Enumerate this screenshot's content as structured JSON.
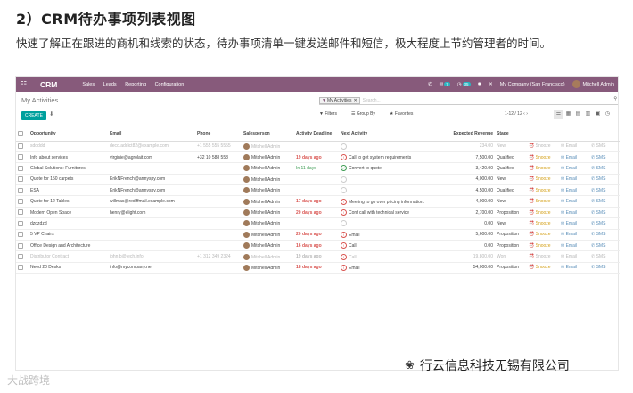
{
  "heading": "2）CRM待办事项列表视图",
  "description": "快速了解正在跟进的商机和线索的状态，待办事项清单一键发送邮件和短信，极大程度上节约管理者的时间。",
  "topbar": {
    "app": "CRM",
    "nav": [
      "Sales",
      "Leads",
      "Reporting",
      "Configuration"
    ],
    "chat_badge": "7",
    "activity_badge": "35",
    "company": "My Company (San Francisco)",
    "user": "Mitchell Admin"
  },
  "control_panel": {
    "breadcrumb": "My Activities",
    "create_label": "CREATE",
    "search_facet": "My Activities",
    "search_placeholder": "Search...",
    "filters_label": "Filters",
    "group_by_label": "Group By",
    "favorites_label": "Favorites",
    "pager": "1-12 / 12"
  },
  "columns": [
    "Opportunity",
    "Email",
    "Phone",
    "Salesperson",
    "Activity Deadline",
    "Next Activity",
    "Expected Revenue",
    "Stage",
    "",
    "",
    ""
  ],
  "rows": [
    {
      "opportunity": "sddddd",
      "email": "deco.addict82@example.com",
      "phone": "+1 555 555 5555",
      "salesperson": "Mitchell Admin",
      "deadline": "",
      "deadline_style": "",
      "activity": "",
      "activity_style": "none",
      "revenue": "234.00",
      "stage": "New",
      "faded": true
    },
    {
      "opportunity": "Info about services",
      "email": "virginie@agrolait.com",
      "phone": "+32 10 588 558",
      "salesperson": "Mitchell Admin",
      "deadline": "19 days ago",
      "deadline_style": "red",
      "activity": "Call to get system requirements",
      "activity_style": "red",
      "revenue": "7,500.00",
      "stage": "Qualified",
      "faded": false
    },
    {
      "opportunity": "Global Solutions: Furnitures",
      "email": "",
      "phone": "",
      "salesperson": "Mitchell Admin",
      "deadline": "In 11 days",
      "deadline_style": "green",
      "activity": "Convert to quote",
      "activity_style": "green",
      "revenue": "3,420.00",
      "stage": "Qualified",
      "faded": false
    },
    {
      "opportunity": "Quote for 150 carpets",
      "email": "ErikNFrench@armyspy.com",
      "phone": "",
      "salesperson": "Mitchell Admin",
      "deadline": "",
      "deadline_style": "",
      "activity": "",
      "activity_style": "none",
      "revenue": "4,000.00",
      "stage": "New",
      "faded": false
    },
    {
      "opportunity": "ESA",
      "email": "ErikNFrench@armyspy.com",
      "phone": "",
      "salesperson": "Mitchell Admin",
      "deadline": "",
      "deadline_style": "",
      "activity": "",
      "activity_style": "none",
      "revenue": "4,500.00",
      "stage": "Qualified",
      "faded": false
    },
    {
      "opportunity": "Quote for 12 Tables",
      "email": "willmac@rediffmail.example.com",
      "phone": "",
      "salesperson": "Mitchell Admin",
      "deadline": "17 days ago",
      "deadline_style": "red",
      "activity": "Meeting to go over pricing information.",
      "activity_style": "red",
      "revenue": "4,000.00",
      "stage": "New",
      "faded": false
    },
    {
      "opportunity": "Modern Open Space",
      "email": "henry@elight.com",
      "phone": "",
      "salesperson": "Mitchell Admin",
      "deadline": "20 days ago",
      "deadline_style": "red",
      "activity": "Conf call with technical service",
      "activity_style": "red",
      "revenue": "2,700.00",
      "stage": "Proposition",
      "faded": false
    },
    {
      "opportunity": "dzdzdzd",
      "email": "",
      "phone": "",
      "salesperson": "Mitchell Admin",
      "deadline": "",
      "deadline_style": "",
      "activity": "",
      "activity_style": "none",
      "revenue": "0.00",
      "stage": "New",
      "faded": false
    },
    {
      "opportunity": "5 VP Chairs",
      "email": "",
      "phone": "",
      "salesperson": "Mitchell Admin",
      "deadline": "20 days ago",
      "deadline_style": "red",
      "activity": "Email",
      "activity_style": "red",
      "revenue": "5,600.00",
      "stage": "Proposition",
      "faded": false
    },
    {
      "opportunity": "Office Design and Architecture",
      "email": "",
      "phone": "",
      "salesperson": "Mitchell Admin",
      "deadline": "16 days ago",
      "deadline_style": "red",
      "activity": "Call",
      "activity_style": "red",
      "revenue": "0.00",
      "stage": "Proposition",
      "faded": false
    },
    {
      "opportunity": "Distributor Contract",
      "email": "john.b@tech.info",
      "phone": "+1 312 349 2324",
      "salesperson": "Mitchell Admin",
      "deadline": "19 days ago",
      "deadline_style": "red",
      "activity": "Call",
      "activity_style": "red",
      "revenue": "19,800.00",
      "stage": "Won",
      "faded": true
    },
    {
      "opportunity": "Need 20 Desks",
      "email": "info@mycompany.net",
      "phone": "",
      "salesperson": "Mitchell Admin",
      "deadline": "18 days ago",
      "deadline_style": "red",
      "activity": "Email",
      "activity_style": "red",
      "revenue": "54,000.00",
      "stage": "Proposition",
      "faded": false
    }
  ],
  "row_buttons": {
    "snooze": "Snooze",
    "email": "Email",
    "sms": "SMS"
  },
  "watermark_left": "大战跨境",
  "watermark_right": "行云信息科技无锡有限公司"
}
